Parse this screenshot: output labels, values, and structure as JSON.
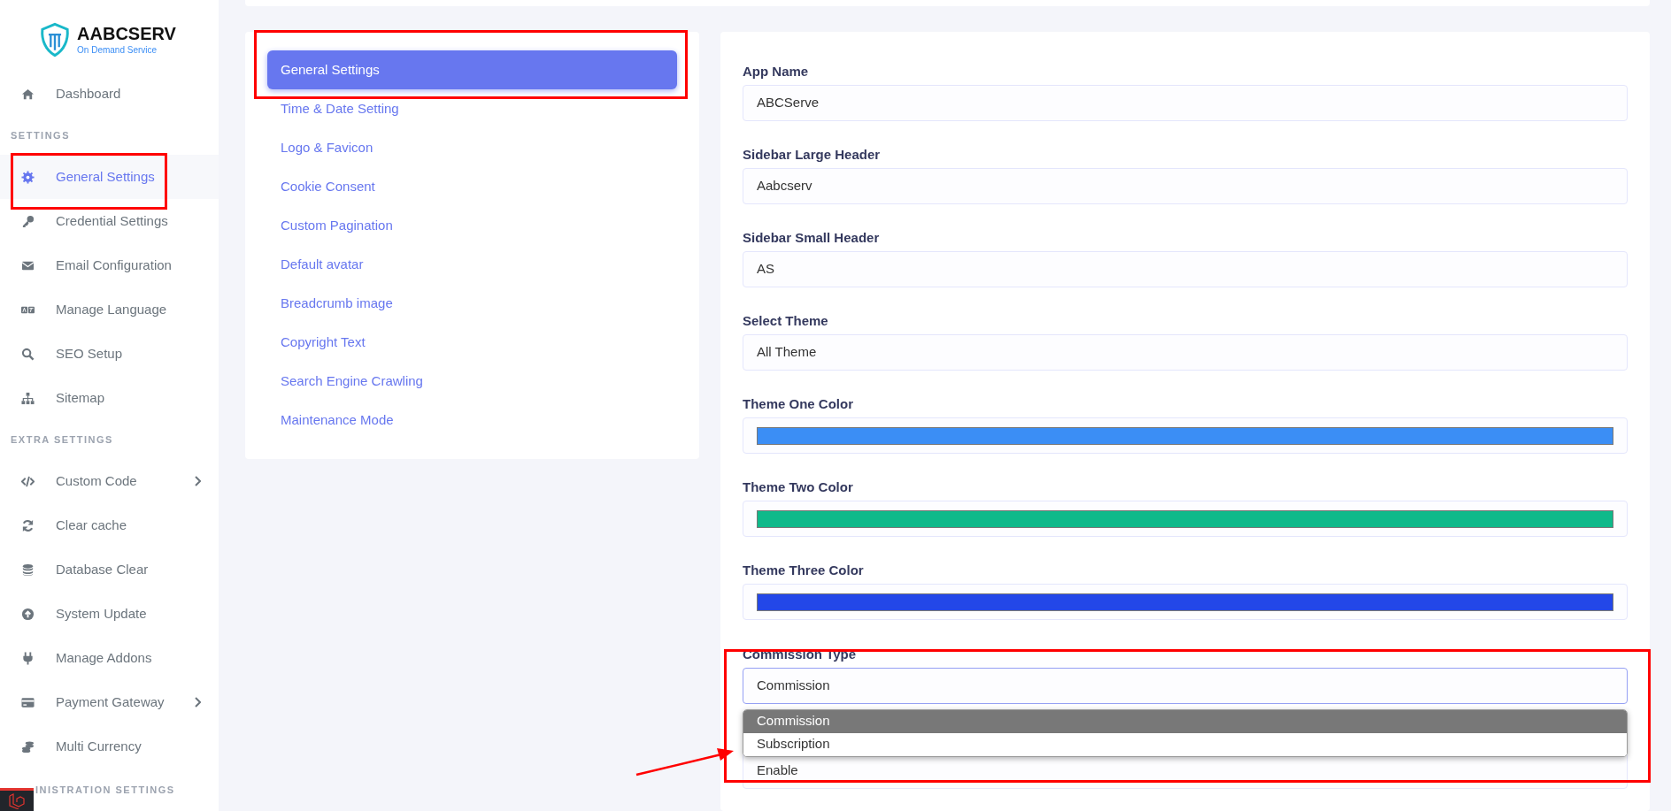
{
  "brand": {
    "name": "AABCSERV",
    "tagline": "On Demand Service"
  },
  "sidebar": {
    "sections": [
      {
        "items": [
          {
            "label": "Dashboard",
            "selected": false,
            "has_submenu": false
          }
        ]
      },
      {
        "title": "SETTINGS",
        "items": [
          {
            "label": "General Settings",
            "selected": true,
            "has_submenu": false
          },
          {
            "label": "Credential Settings",
            "selected": false,
            "has_submenu": false
          },
          {
            "label": "Email Configuration",
            "selected": false,
            "has_submenu": false
          },
          {
            "label": "Manage Language",
            "selected": false,
            "has_submenu": false
          },
          {
            "label": "SEO Setup",
            "selected": false,
            "has_submenu": false
          },
          {
            "label": "Sitemap",
            "selected": false,
            "has_submenu": false
          }
        ]
      },
      {
        "title": "EXTRA SETTINGS",
        "items": [
          {
            "label": "Custom Code",
            "selected": false,
            "has_submenu": true
          },
          {
            "label": "Clear cache",
            "selected": false,
            "has_submenu": false
          },
          {
            "label": "Database Clear",
            "selected": false,
            "has_submenu": false
          },
          {
            "label": "System Update",
            "selected": false,
            "has_submenu": false
          },
          {
            "label": "Manage Addons",
            "selected": false,
            "has_submenu": false
          },
          {
            "label": "Payment Gateway",
            "selected": false,
            "has_submenu": true
          },
          {
            "label": "Multi Currency",
            "selected": false,
            "has_submenu": false
          }
        ]
      },
      {
        "title": "INISTRATION SETTINGS"
      }
    ]
  },
  "settings_menu": [
    {
      "label": "General Settings",
      "selected": true
    },
    {
      "label": "Time & Date Setting",
      "selected": false
    },
    {
      "label": "Logo & Favicon",
      "selected": false
    },
    {
      "label": "Cookie Consent",
      "selected": false
    },
    {
      "label": "Custom Pagination",
      "selected": false
    },
    {
      "label": "Default avatar",
      "selected": false
    },
    {
      "label": "Breadcrumb image",
      "selected": false
    },
    {
      "label": "Copyright Text",
      "selected": false
    },
    {
      "label": "Search Engine Crawling",
      "selected": false
    },
    {
      "label": "Maintenance Mode",
      "selected": false
    }
  ],
  "form": [
    {
      "kind": "text",
      "label": "App Name",
      "value": "ABCServe"
    },
    {
      "kind": "text",
      "label": "Sidebar Large Header",
      "value": "Aabcserv"
    },
    {
      "kind": "text",
      "label": "Sidebar Small Header",
      "value": "AS"
    },
    {
      "kind": "text",
      "label": "Select Theme",
      "value": "All Theme"
    },
    {
      "kind": "color",
      "label": "Theme One Color",
      "color": "#3b8ef5"
    },
    {
      "kind": "color",
      "label": "Theme Two Color",
      "color": "#0fb98a"
    },
    {
      "kind": "color",
      "label": "Theme Three Color",
      "color": "#2347e8"
    },
    {
      "kind": "select",
      "label": "Commission Type",
      "value": "Commission",
      "expanded": true,
      "options": [
        {
          "label": "Commission",
          "selected": true
        },
        {
          "label": "Subscription",
          "selected": false
        }
      ]
    },
    {
      "kind": "text",
      "value": "Enable"
    }
  ]
}
